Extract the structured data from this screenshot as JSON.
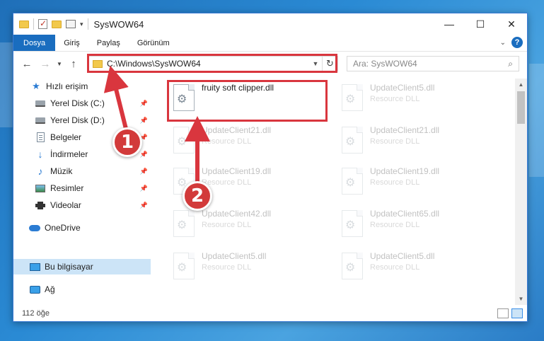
{
  "window": {
    "title": "SysWOW64",
    "minimize": "—",
    "maximize": "☐",
    "close": "✕"
  },
  "ribbon": {
    "tabs": [
      "Dosya",
      "Giriş",
      "Paylaş",
      "Görünüm"
    ],
    "expand_glyph": "⌄",
    "help_glyph": "?"
  },
  "nav": {
    "back": "←",
    "forward": "→",
    "recent": "▼",
    "up": "↑",
    "address": "C:\\Windows\\SysWOW64",
    "address_dropdown": "▼",
    "refresh": "↻",
    "search_placeholder": "Ara: SysWOW64",
    "search_glyph": "⌕"
  },
  "sidebar": {
    "pin_glyph": "📌",
    "items": [
      {
        "label": "Hızlı erişim",
        "icon": "star-icon"
      },
      {
        "label": "Yerel Disk (C:)",
        "icon": "drive-icon"
      },
      {
        "label": "Yerel Disk (D:)",
        "icon": "drive-icon"
      },
      {
        "label": "Belgeler",
        "icon": "documents-icon"
      },
      {
        "label": "İndirmeler",
        "icon": "download-icon"
      },
      {
        "label": "Müzik",
        "icon": "music-icon"
      },
      {
        "label": "Resimler",
        "icon": "pictures-icon"
      },
      {
        "label": "Videolar",
        "icon": "videos-icon"
      },
      {
        "label": "OneDrive",
        "icon": "cloud-icon"
      },
      {
        "label": "Bu bilgisayar",
        "icon": "computer-icon"
      },
      {
        "label": "Ağ",
        "icon": "network-icon"
      }
    ]
  },
  "files": [
    {
      "name": "fruity soft clipper.dll",
      "type": ""
    },
    {
      "name": "UpdateClient5.dll",
      "type": "Resource DLL"
    },
    {
      "name": "UpdateClient21.dll",
      "type": "Resource DLL"
    },
    {
      "name": "UpdateClient21.dll",
      "type": "Resource DLL"
    },
    {
      "name": "UpdateClient19.dll",
      "type": "Resource DLL"
    },
    {
      "name": "UpdateClient19.dll",
      "type": "Resource DLL"
    },
    {
      "name": "UpdateClient42.dll",
      "type": "Resource DLL"
    },
    {
      "name": "UpdateClient65.dll",
      "type": "Resource DLL"
    },
    {
      "name": "UpdateClient5.dll",
      "type": "Resource DLL"
    },
    {
      "name": "UpdateClient5.dll",
      "type": "Resource DLL"
    }
  ],
  "status": {
    "count": "112 öğe"
  },
  "annotations": {
    "step1": "1",
    "step2": "2"
  },
  "colors": {
    "accent": "#1a6dbf",
    "highlight_red": "#d9363e",
    "selected_bg": "#cce4f7"
  }
}
